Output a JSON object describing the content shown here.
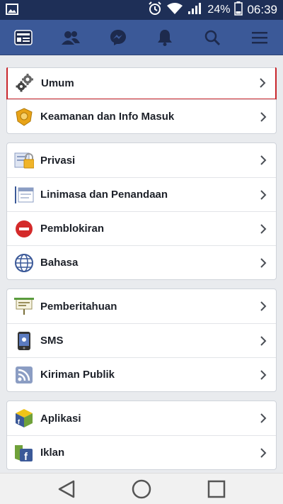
{
  "status_bar": {
    "battery": "24%",
    "time": "06:39",
    "icons": [
      "image-notification-icon",
      "alarm-icon",
      "wifi-icon",
      "signal-icon",
      "battery-icon"
    ]
  },
  "nav": {
    "icons": [
      "news-feed-icon",
      "friends-icon",
      "messenger-icon",
      "notifications-bell-icon",
      "search-icon",
      "menu-icon"
    ]
  },
  "settings": {
    "groups": [
      [
        {
          "label": "Umum",
          "icon": "gears-icon",
          "selected": true
        },
        {
          "label": "Keamanan dan Info Masuk",
          "icon": "security-badge-icon"
        }
      ],
      [
        {
          "label": "Privasi",
          "icon": "privacy-lock-icon"
        },
        {
          "label": "Linimasa dan Penandaan",
          "icon": "timeline-icon"
        },
        {
          "label": "Pemblokiran",
          "icon": "block-icon"
        },
        {
          "label": "Bahasa",
          "icon": "globe-icon"
        }
      ],
      [
        {
          "label": "Pemberitahuan",
          "icon": "notification-sign-icon"
        },
        {
          "label": "SMS",
          "icon": "sms-phone-icon"
        },
        {
          "label": "Kiriman Publik",
          "icon": "rss-icon"
        }
      ],
      [
        {
          "label": "Aplikasi",
          "icon": "apps-cube-icon"
        },
        {
          "label": "Iklan",
          "icon": "ads-facebook-icon"
        }
      ]
    ]
  },
  "system_nav": {
    "icons": [
      "back-icon",
      "home-icon",
      "recents-icon"
    ]
  },
  "colors": {
    "status_bar": "#1e2f57",
    "nav_bar": "#3b5998",
    "selected_outline": "#c9262c",
    "background": "#e9ebee"
  }
}
